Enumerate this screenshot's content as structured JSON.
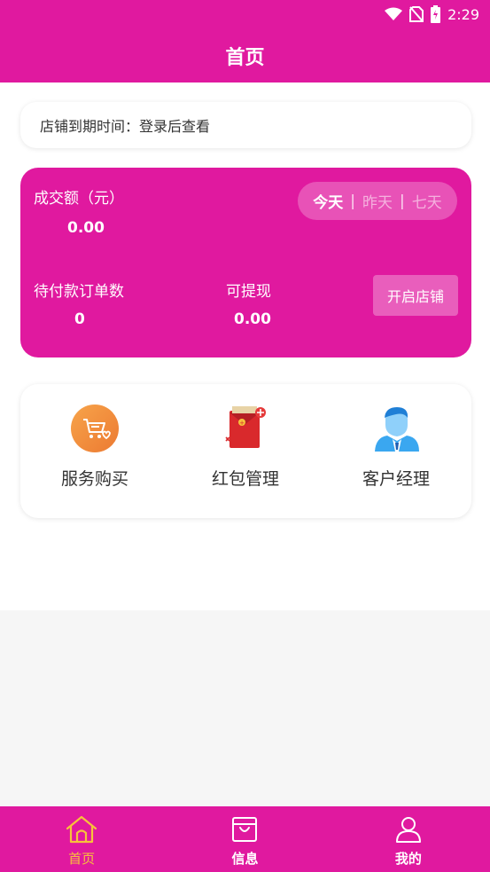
{
  "status_bar": {
    "time": "2:29"
  },
  "header": {
    "title": "首页"
  },
  "expiry": {
    "text": "店铺到期时间：登录后查看"
  },
  "stats": {
    "turnover_label": "成交额（元）",
    "turnover_value": "0.00",
    "range_options": [
      "今天",
      "昨天",
      "七天"
    ],
    "range_separator": "|",
    "pending_orders_label": "待付款订单数",
    "pending_orders_value": "0",
    "withdrawable_label": "可提现",
    "withdrawable_value": "0.00",
    "open_shop_label": "开启店铺"
  },
  "services": [
    {
      "label": "服务购买",
      "icon": "shopping-cart-icon"
    },
    {
      "label": "红包管理",
      "icon": "red-envelope-icon"
    },
    {
      "label": "客户经理",
      "icon": "account-manager-icon"
    }
  ],
  "bottom_nav": [
    {
      "label": "首页",
      "icon": "home-icon",
      "active": true
    },
    {
      "label": "信息",
      "icon": "shopping-bag-icon",
      "active": false
    },
    {
      "label": "我的",
      "icon": "user-icon",
      "active": false
    }
  ],
  "colors": {
    "brand": "#e0199f",
    "active_nav": "#f7c23b",
    "cart_icon": "#f08a3c",
    "red_envelope": "#d9292c",
    "manager_icon": "#3aa7f0"
  }
}
